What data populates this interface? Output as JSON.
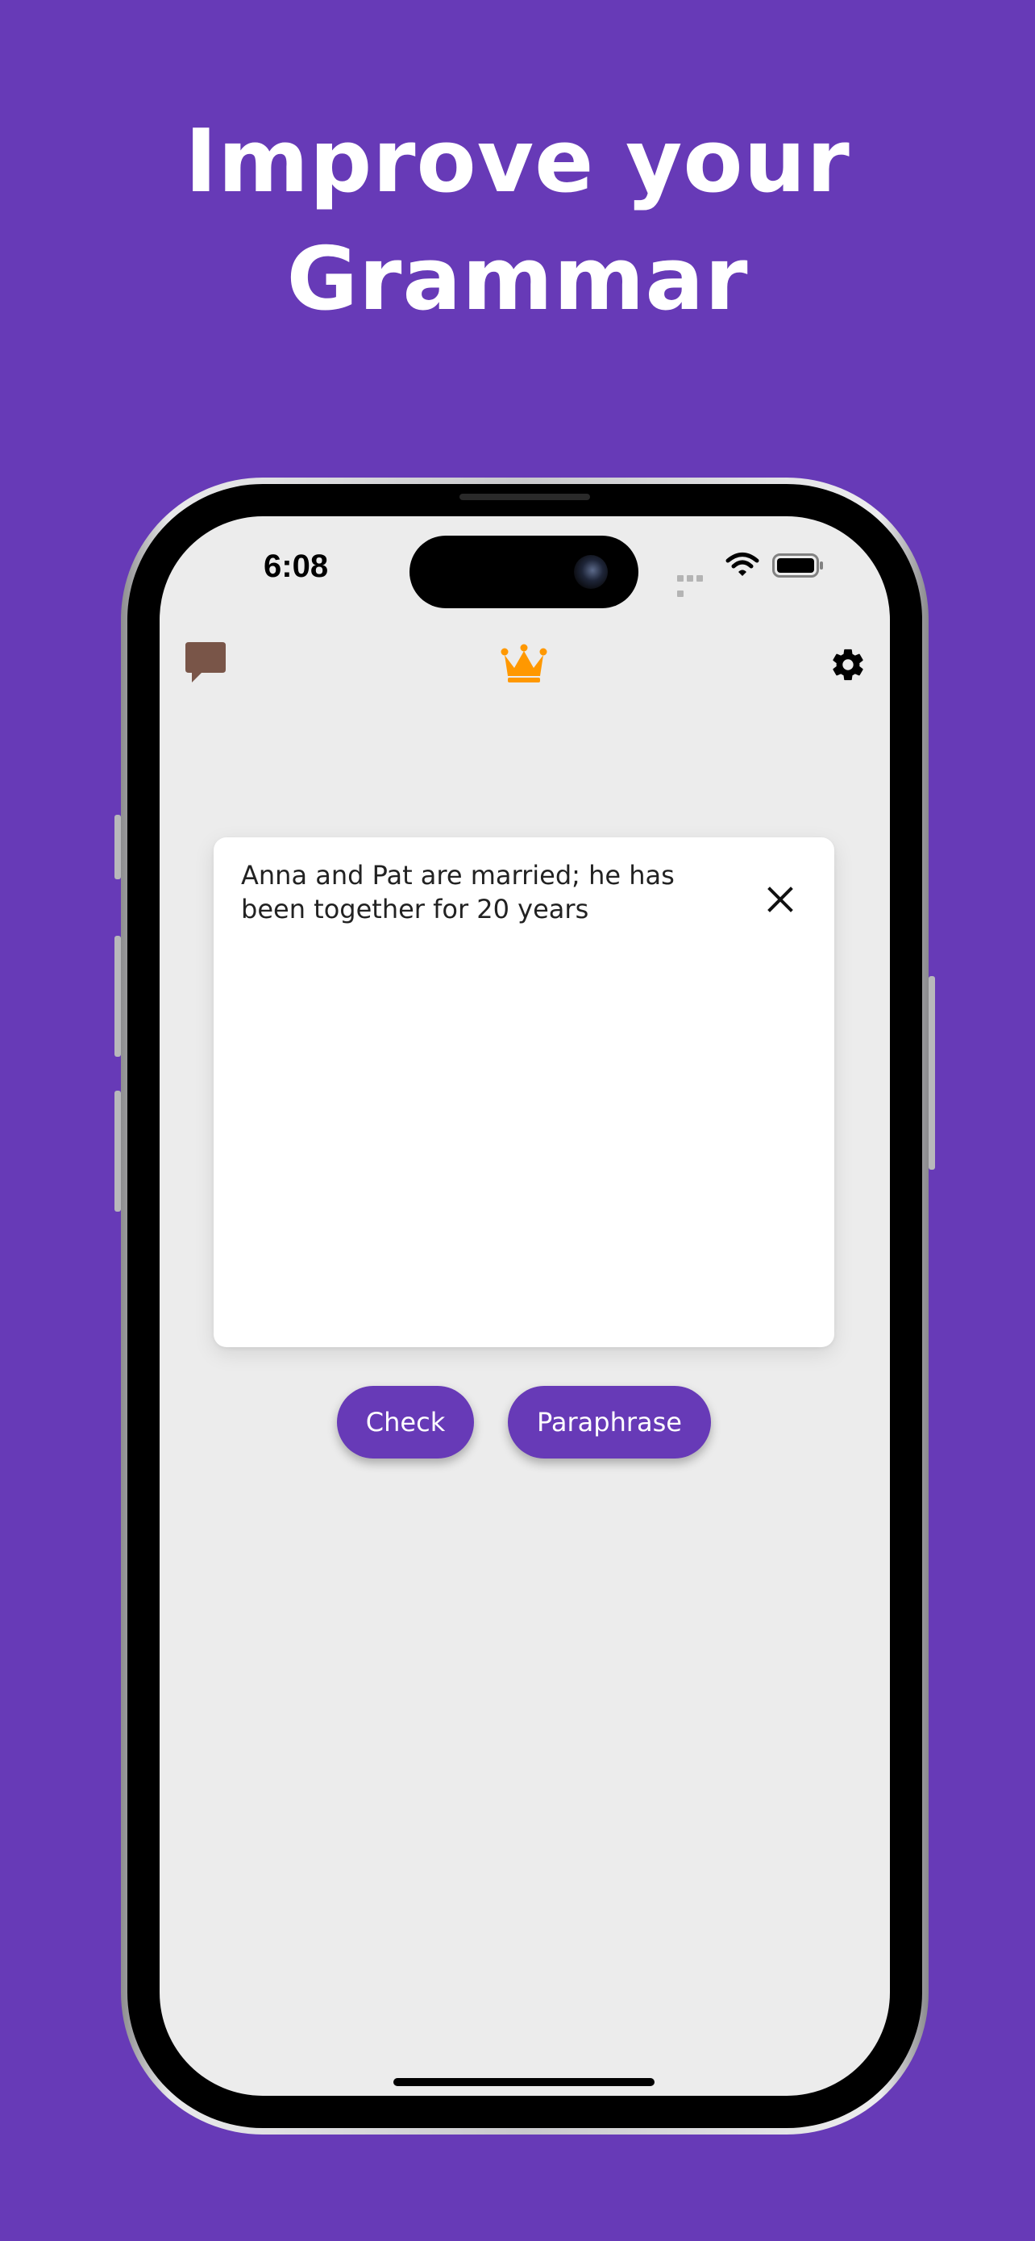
{
  "headline": {
    "line1": "Improve your",
    "line2": "Grammar"
  },
  "status_bar": {
    "time": "6:08",
    "icons": [
      "cellular-signal-icon",
      "wifi-icon",
      "battery-icon"
    ]
  },
  "toolbar": {
    "left_icon": "feedback-chat-icon",
    "center_icon": "premium-crown-icon",
    "right_icon": "settings-gear-icon"
  },
  "editor": {
    "text": "Anna and Pat are married; he has been together for 20 years",
    "clear_icon": "close-icon"
  },
  "actions": {
    "check_label": "Check",
    "paraphrase_label": "Paraphrase"
  },
  "colors": {
    "background": "#673ab7",
    "accent": "#673ab7",
    "screen_bg": "#ececec",
    "chat_icon": "#795548",
    "crown_icon": "#ff9800"
  }
}
